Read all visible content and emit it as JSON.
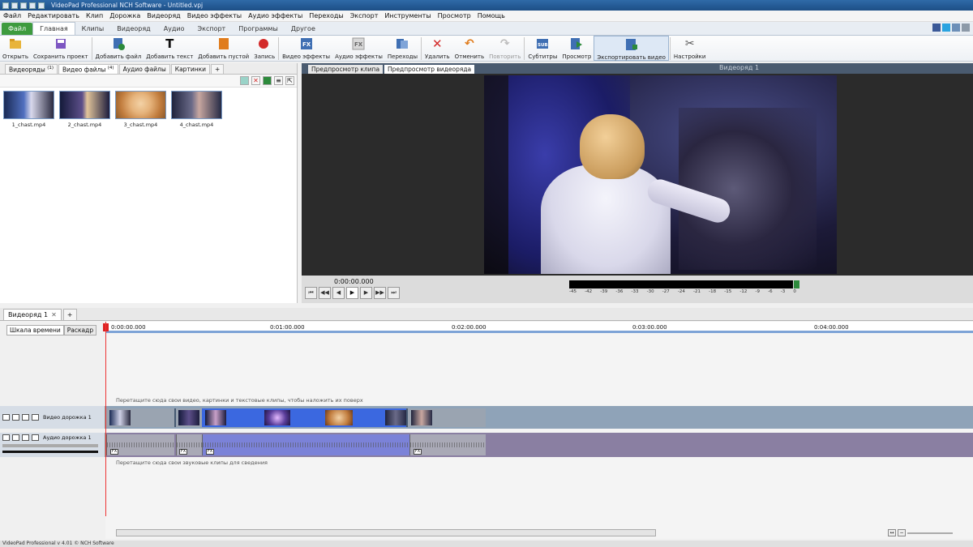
{
  "window": {
    "title": "VideoPad Professional NCH Software - Untitled.vpj"
  },
  "menu": [
    "Файл",
    "Редактировать",
    "Клип",
    "Дорожка",
    "Видеоряд",
    "Видео эффекты",
    "Аудио эффекты",
    "Переходы",
    "Экспорт",
    "Инструменты",
    "Просмотр",
    "Помощь"
  ],
  "ribbon_tabs": [
    "Файл",
    "Главная",
    "Клипы",
    "Видеоряд",
    "Аудио",
    "Экспорт",
    "Программы",
    "Другое"
  ],
  "toolbar": [
    {
      "label": "Открыть",
      "icon": "folder-open-icon",
      "color": "#e8b43a"
    },
    {
      "label": "Сохранить проект",
      "icon": "save-icon",
      "color": "#7d56c2"
    },
    {
      "label": "Добавить файл",
      "icon": "add-file-icon",
      "color": "#2c8a3b"
    },
    {
      "label": "Добавить текст",
      "icon": "add-text-icon",
      "color": "#222222"
    },
    {
      "label": "Добавить пустой",
      "icon": "add-blank-icon",
      "color": "#e07c1c"
    },
    {
      "label": "Запись",
      "icon": "record-icon",
      "color": "#d32a2a"
    },
    {
      "label": "Видео эффекты",
      "icon": "video-effects-icon",
      "color": "#3f6fb3"
    },
    {
      "label": "Аудио эффекты",
      "icon": "audio-effects-icon",
      "color": "#bdbdbd"
    },
    {
      "label": "Переходы",
      "icon": "transitions-icon",
      "color": "#3f6fb3"
    },
    {
      "label": "Удалить",
      "icon": "delete-icon",
      "color": "#d32a2a"
    },
    {
      "label": "Отменить",
      "icon": "undo-icon",
      "color": "#e07c1c"
    },
    {
      "label": "Повторить",
      "icon": "redo-icon",
      "color": "#bdbdbd"
    },
    {
      "label": "Субтитры",
      "icon": "subtitles-icon",
      "color": "#3f6fb3"
    },
    {
      "label": "Просмотр",
      "icon": "preview-icon",
      "color": "#2c8a3b"
    },
    {
      "label": "Экспортировать видео",
      "icon": "export-video-icon",
      "color": "#3f6fb3"
    },
    {
      "label": "Настройки",
      "icon": "settings-icon",
      "color": "#555555"
    }
  ],
  "bin": {
    "tabs": [
      {
        "label": "Видеоряды",
        "count": "(1)"
      },
      {
        "label": "Видео файлы",
        "count": "(4)"
      },
      {
        "label": "Аудио файлы",
        "count": ""
      },
      {
        "label": "Картинки",
        "count": ""
      }
    ],
    "clips": [
      {
        "name": "1_chast.mp4"
      },
      {
        "name": "2_chast.mp4"
      },
      {
        "name": "3_chast.mp4"
      },
      {
        "name": "4_chast.mp4"
      }
    ]
  },
  "preview": {
    "tabs": [
      "Предпросмотр клипа",
      "Предпросмотр видеоряда"
    ],
    "sequence_label": "Видеоряд 1",
    "timecode": "0:00:00.000",
    "meter_scale": [
      "-45",
      "-42",
      "-39",
      "-36",
      "-33",
      "-30",
      "-27",
      "-24",
      "-21",
      "-18",
      "-15",
      "-12",
      "-9",
      "-6",
      "-3",
      "0"
    ]
  },
  "timeline": {
    "sequence_tab": "Видеоряд 1",
    "view_tabs": [
      "Шкала времени",
      "Раскадр"
    ],
    "ruler": [
      "0:00:00.000",
      "0:01:00.000",
      "0:02:00.000",
      "0:03:00.000",
      "0:04:00.000"
    ],
    "overlay_hint": "Перетащите сюда свои видео, картинки и текстовые клипы, чтобы наложить их поверх",
    "video_track_label": "Видео дорожка 1",
    "audio_track_label": "Аудио дорожка 1",
    "audio_hint": "Перетащите сюда свои звуковые клипы для сведения"
  },
  "status": "VideoPad Professional v 4.01 © NCH Software"
}
